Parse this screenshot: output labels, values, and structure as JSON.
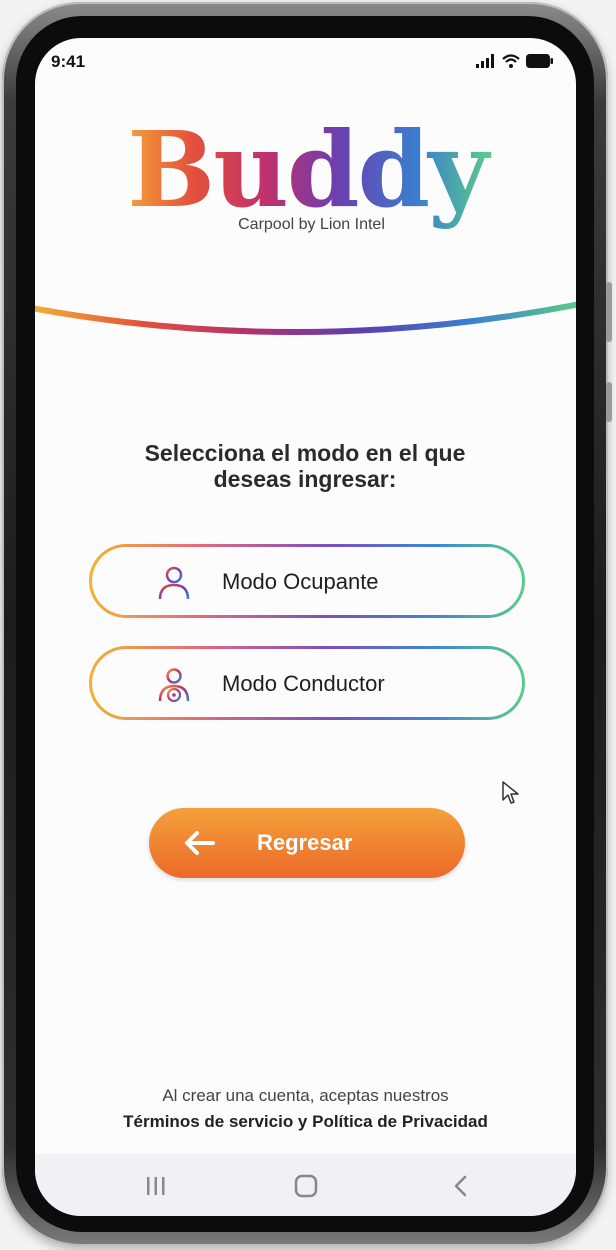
{
  "status_bar": {
    "time": "9:41"
  },
  "brand": {
    "name": "Buddy",
    "tagline": "Carpool by Lion Intel",
    "colors": [
      "#f2b233",
      "#e4503b",
      "#c0306e",
      "#6a3fb0",
      "#3a6fc8",
      "#5ccc88"
    ]
  },
  "prompt": {
    "line1": "Selecciona el modo en el que",
    "line2": "deseas ingresar:"
  },
  "modes": [
    {
      "label": "Modo Ocupante",
      "icon": "user-icon"
    },
    {
      "label": "Modo Conductor",
      "icon": "driver-icon"
    }
  ],
  "back_button": {
    "label": "Regresar",
    "icon": "arrow-left-icon",
    "color": "#ec6a2a"
  },
  "legal": {
    "line1": "Al crear una cuenta, aceptas nuestros",
    "line2": "Términos de servicio y Política de Privacidad"
  },
  "nav_bar": {
    "items": [
      "recent-apps-icon",
      "home-icon",
      "back-icon"
    ]
  }
}
